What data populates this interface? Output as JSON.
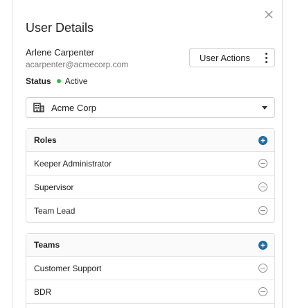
{
  "dialog": {
    "title": "User Details",
    "close_icon": "close-icon"
  },
  "user": {
    "name": "Arlene Carpenter",
    "email": "acarpenter@acmecorp.com"
  },
  "actions": {
    "label": "User Actions",
    "icon": "kebab-menu-icon"
  },
  "status": {
    "label": "Status",
    "value": "Active",
    "color": "#3cb54a"
  },
  "organization": {
    "selected": "Acme Corp",
    "icon": "building-icon"
  },
  "roles": {
    "title": "Roles",
    "items": [
      {
        "label": "Keeper Administrator"
      },
      {
        "label": "Supervisor"
      },
      {
        "label": "Team Lead"
      }
    ]
  },
  "teams": {
    "title": "Teams",
    "items": [
      {
        "label": "Customer Support"
      },
      {
        "label": "BDR"
      }
    ]
  },
  "colors": {
    "accent": "#1f6ca3",
    "border": "#dedede"
  }
}
